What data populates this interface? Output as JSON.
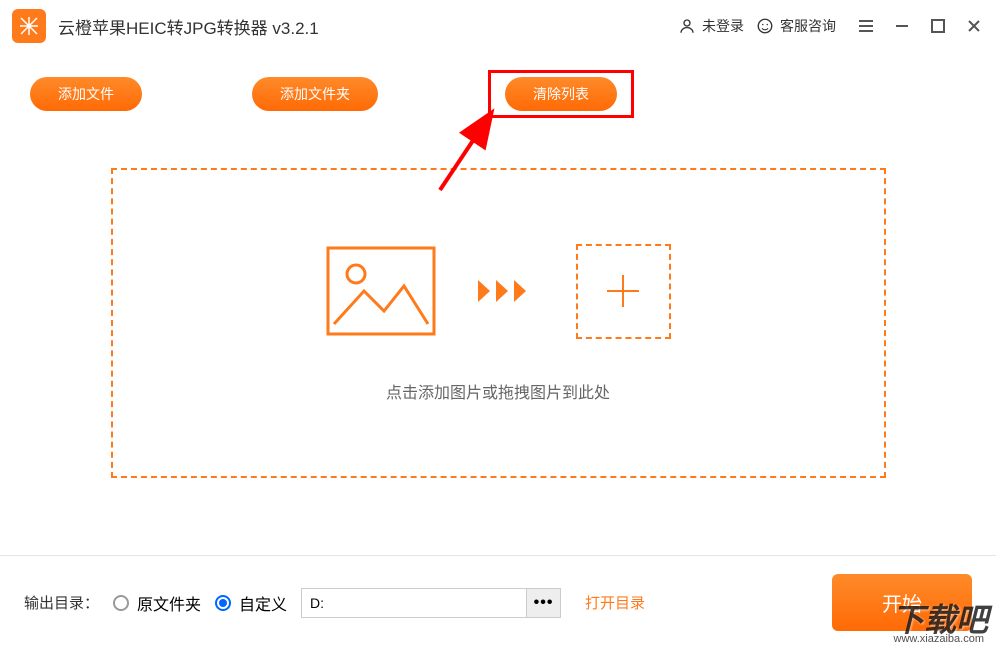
{
  "app": {
    "title": "云橙苹果HEIC转JPG转换器 v3.2.1"
  },
  "titlebar": {
    "login_status": "未登录",
    "support": "客服咨询"
  },
  "toolbar": {
    "add_file": "添加文件",
    "add_folder": "添加文件夹",
    "clear_list": "清除列表"
  },
  "dropzone": {
    "hint": "点击添加图片或拖拽图片到此处"
  },
  "output": {
    "label": "输出目录：",
    "option_original": "原文件夹",
    "option_custom": "自定义",
    "path_value": "D:",
    "browse_dots": "•••",
    "open_dir": "打开目录",
    "start": "开始"
  },
  "watermark": {
    "main": "下载吧",
    "sub": "www.xiazaiba.com"
  }
}
